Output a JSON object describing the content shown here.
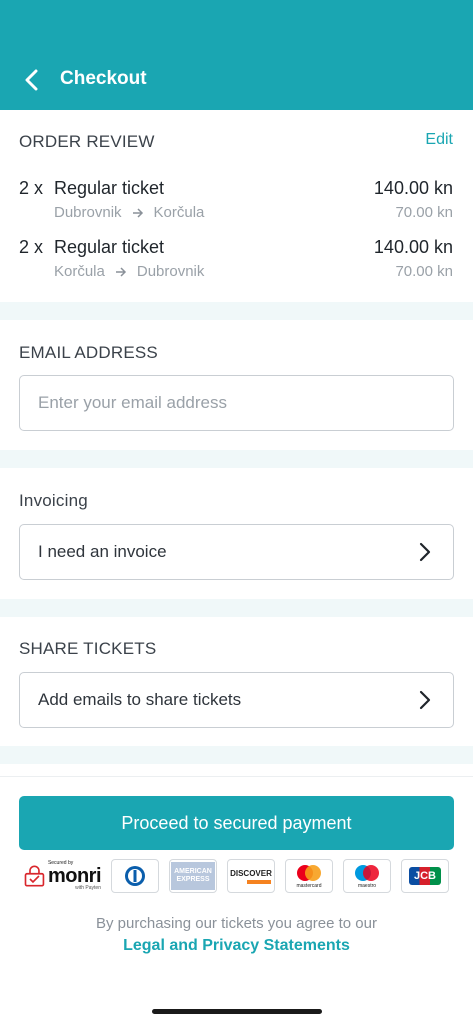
{
  "header": {
    "title": "Checkout"
  },
  "order_review": {
    "title": "ORDER REVIEW",
    "edit_label": "Edit",
    "items": [
      {
        "qty": "2 x",
        "name": "Regular ticket",
        "total": "140.00 kn",
        "from": "Dubrovnik",
        "to": "Korčula",
        "unit_price": "70.00 kn"
      },
      {
        "qty": "2 x",
        "name": "Regular ticket",
        "total": "140.00 kn",
        "from": "Korčula",
        "to": "Dubrovnik",
        "unit_price": "70.00 kn"
      }
    ]
  },
  "email": {
    "title": "EMAIL ADDRESS",
    "placeholder": "Enter your email address",
    "value": ""
  },
  "invoicing": {
    "title": "Invoicing",
    "field_label": "I need an invoice"
  },
  "share": {
    "title": "SHARE TICKETS",
    "field_label": "Add emails to share tickets"
  },
  "payment": {
    "button_label": "Proceed to secured payment",
    "provider_logo": "monri",
    "provider_secured_text": "Secured by",
    "provider_sub_text": "with Payten",
    "card_logos": [
      "diners-icon",
      "amex-icon",
      "discover-icon",
      "mastercard-icon",
      "maestro-icon",
      "jcb-icon"
    ],
    "amex_text": "AMERICAN EXPRESS",
    "discover_text": "DISCOVER",
    "mastercard_text": "mastercard",
    "maestro_text": "maestro",
    "jcb_text": "JCB"
  },
  "footer": {
    "terms_text": "By purchasing our tickets you agree to our",
    "terms_link": "Legal and Privacy Statements"
  },
  "colors": {
    "accent": "#1aa6b2",
    "divider": "#f0f8f9",
    "muted": "#9aa1a8"
  }
}
